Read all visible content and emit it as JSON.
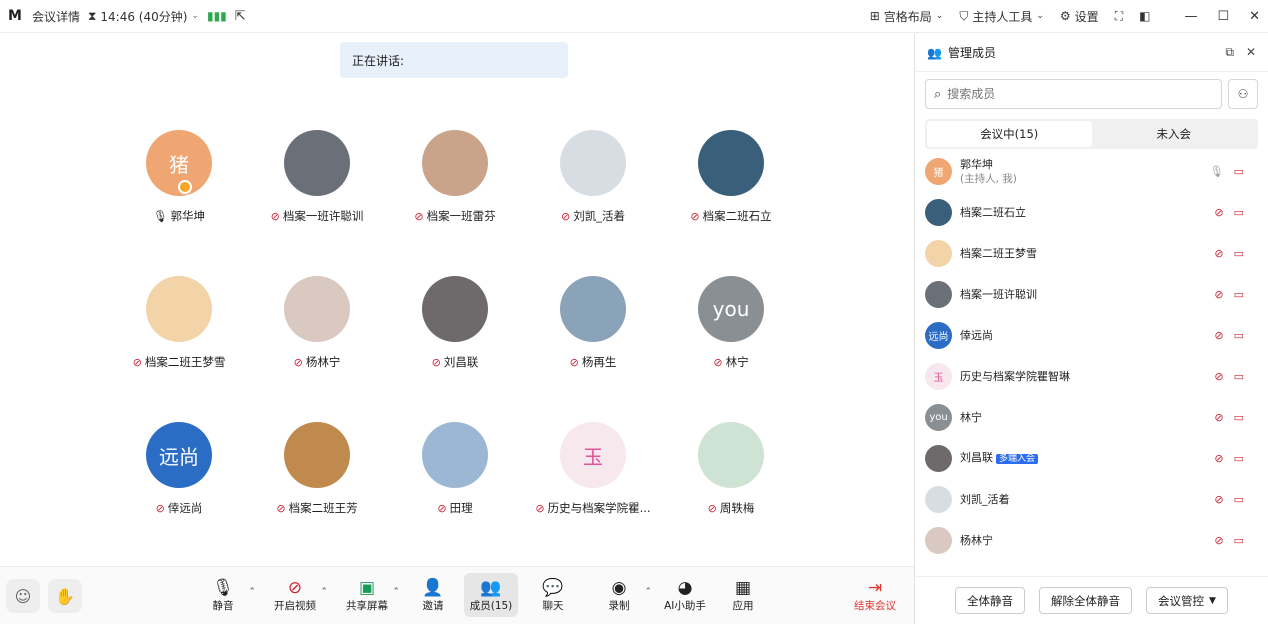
{
  "topbar": {
    "logo": "M",
    "meeting_details": "会议详情",
    "timer": "14:46 (40分钟)",
    "grid_layout": "宫格布局",
    "host_tools": "主持人工具",
    "settings": "设置"
  },
  "main": {
    "speaking": "正在讲话:",
    "participants": [
      {
        "name": "郭华坤",
        "avatar_color": "#f0a672",
        "avatar_text": "猪",
        "host": true
      },
      {
        "name": "档案一班许聪训",
        "avatar_color": "#6b6f78",
        "avatar_text": ""
      },
      {
        "name": "档案一班雷芬",
        "avatar_color": "#c9a48a",
        "avatar_text": ""
      },
      {
        "name": "刘凯_活着",
        "avatar_color": "#d8dde3",
        "avatar_text": ""
      },
      {
        "name": "档案二班石立",
        "avatar_color": "#3a5f7a",
        "avatar_text": ""
      },
      {
        "name": "档案二班王梦雪",
        "avatar_color": "#f3d3a8",
        "avatar_text": ""
      },
      {
        "name": "杨林宁",
        "avatar_color": "#d9c9c0",
        "avatar_text": ""
      },
      {
        "name": "刘昌联",
        "avatar_color": "#6e6a6b",
        "avatar_text": ""
      },
      {
        "name": "杨再生",
        "avatar_color": "#8aa3b8",
        "avatar_text": ""
      },
      {
        "name": "林宁",
        "avatar_color": "#8a8f94",
        "avatar_text": "you"
      },
      {
        "name": "倖远尚",
        "avatar_color": "#2b6cc4",
        "avatar_text": "远尚"
      },
      {
        "name": "档案二班王芳",
        "avatar_color": "#c08a4e",
        "avatar_text": ""
      },
      {
        "name": "田理",
        "avatar_color": "#9bb7d4",
        "avatar_text": ""
      },
      {
        "name": "历史与档案学院瞿...",
        "avatar_color": "#f6e8ec",
        "avatar_text": "玉"
      },
      {
        "name": "周轶梅",
        "avatar_color": "#cfe3d4",
        "avatar_text": ""
      }
    ]
  },
  "bottombar": {
    "mute": "静音",
    "video": "开启视频",
    "share": "共享屏幕",
    "invite": "邀请",
    "members": "成员(15)",
    "chat": "聊天",
    "record": "录制",
    "ai": "AI小助手",
    "apps": "应用",
    "end": "结束会议"
  },
  "panel": {
    "title": "管理成员",
    "search_placeholder": "搜索成员",
    "tab_in": "会议中(15)",
    "tab_out": "未入会",
    "members": [
      {
        "name": "郭华坤",
        "sub": "(主持人, 我)",
        "avatar_color": "#f0a672",
        "avatar_text": "猪",
        "badge": ""
      },
      {
        "name": "档案二班石立",
        "sub": "",
        "avatar_color": "#3a5f7a",
        "avatar_text": "",
        "badge": ""
      },
      {
        "name": "档案二班王梦雪",
        "sub": "",
        "avatar_color": "#f3d3a8",
        "avatar_text": "",
        "badge": ""
      },
      {
        "name": "档案一班许聪训",
        "sub": "",
        "avatar_color": "#6b6f78",
        "avatar_text": "",
        "badge": ""
      },
      {
        "name": "倖远尚",
        "sub": "",
        "avatar_color": "#2b6cc4",
        "avatar_text": "远尚",
        "badge": ""
      },
      {
        "name": "历史与档案学院瞿智琳",
        "sub": "",
        "avatar_color": "#f6e8ec",
        "avatar_text": "玉",
        "badge": ""
      },
      {
        "name": "林宁",
        "sub": "",
        "avatar_color": "#8a8f94",
        "avatar_text": "you",
        "badge": ""
      },
      {
        "name": "刘昌联",
        "sub": "",
        "avatar_color": "#6e6a6b",
        "avatar_text": "",
        "badge": "多端入会"
      },
      {
        "name": "刘凯_活着",
        "sub": "",
        "avatar_color": "#d8dde3",
        "avatar_text": "",
        "badge": ""
      },
      {
        "name": "杨林宁",
        "sub": "",
        "avatar_color": "#d9c9c0",
        "avatar_text": "",
        "badge": ""
      }
    ],
    "mute_all": "全体静音",
    "unmute_all": "解除全体静音",
    "control": "会议管控"
  }
}
